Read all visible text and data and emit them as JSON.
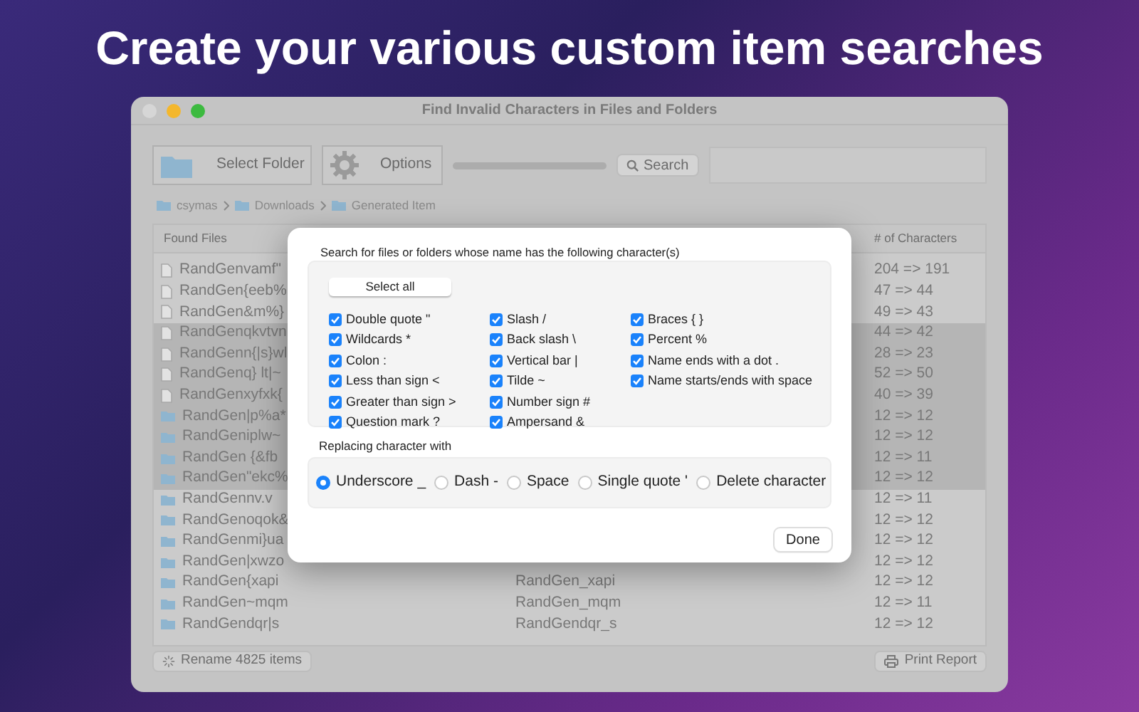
{
  "headline": "Create your various custom item searches",
  "window": {
    "title": "Find Invalid Characters in Files and Folders"
  },
  "toolbar": {
    "select_folder": "Select Folder",
    "options": "Options",
    "progress": {
      "level": 0
    },
    "search": "Search"
  },
  "breadcrumb": [
    "csymas",
    "Downloads",
    "Generated Item"
  ],
  "table": {
    "columns": [
      "Found Files",
      "# of Characters"
    ],
    "rows": [
      {
        "kind": "file",
        "selected": false,
        "name": "RandGenvamf\"",
        "characters": "204 => 191"
      },
      {
        "kind": "file",
        "selected": false,
        "name": "RandGen{eeb%",
        "characters": "47 => 44"
      },
      {
        "kind": "file",
        "selected": false,
        "name": "RandGen&m%}",
        "characters": "49 => 43"
      },
      {
        "kind": "file",
        "selected": true,
        "name": "RandGenqkvtvn",
        "characters": "44 => 42"
      },
      {
        "kind": "file",
        "selected": true,
        "name": "RandGenn{|s}wl",
        "characters": "28 => 23"
      },
      {
        "kind": "file",
        "selected": true,
        "name": "RandGenq} lt|~",
        "characters": "52 => 50"
      },
      {
        "kind": "file",
        "selected": true,
        "name": "RandGenxyfxk{",
        "characters": "40 => 39"
      },
      {
        "kind": "folder",
        "selected": true,
        "name": "RandGen|p%a*",
        "characters": "12 => 12"
      },
      {
        "kind": "folder",
        "selected": true,
        "name": "RandGeniplw~",
        "characters": "12 => 12"
      },
      {
        "kind": "folder",
        "selected": true,
        "name": "RandGen {&fb",
        "characters": "12 => 11"
      },
      {
        "kind": "folder",
        "selected": true,
        "name": "RandGen\"ekc%",
        "characters": "12 => 12"
      },
      {
        "kind": "folder",
        "selected": false,
        "name": "RandGennv.v",
        "characters": "12 => 11"
      },
      {
        "kind": "folder",
        "selected": false,
        "name": "RandGenoqok&",
        "characters": "12 => 12"
      },
      {
        "kind": "folder",
        "selected": false,
        "name": "RandGenmi}ua",
        "characters": "12 => 12"
      },
      {
        "kind": "folder",
        "selected": false,
        "name": "RandGen|xwzo",
        "characters": "12 => 12"
      },
      {
        "kind": "folder",
        "selected": false,
        "name": "RandGen{xapi",
        "column_2": "RandGen_xapi",
        "characters": "12 => 12"
      },
      {
        "kind": "folder",
        "selected": false,
        "name": "RandGen~mqm",
        "column_2": "RandGen_mqm",
        "characters": "12 => 11"
      },
      {
        "kind": "folder",
        "selected": false,
        "name": "RandGendqr|s",
        "column_2": "RandGendqr_s",
        "characters": "12 => 12"
      }
    ]
  },
  "footer": {
    "rename": "Rename 4825 items",
    "print": "Print Report"
  },
  "dialog": {
    "prompt": "Search for files or folders whose name has the following character(s)",
    "select_all": "Select all",
    "option_columns": [
      [
        {
          "label": "Double quote \"",
          "checked": true
        },
        {
          "label": "Wildcards *",
          "checked": true
        },
        {
          "label": "Colon :",
          "checked": true
        },
        {
          "label": "Less than sign <",
          "checked": true
        },
        {
          "label": "Greater than sign >",
          "checked": true
        },
        {
          "label": "Question mark ?",
          "checked": true
        }
      ],
      [
        {
          "label": "Slash /",
          "checked": true
        },
        {
          "label": "Back slash \\",
          "checked": true
        },
        {
          "label": "Vertical bar |",
          "checked": true
        },
        {
          "label": "Tilde ~",
          "checked": true
        },
        {
          "label": "Number sign #",
          "checked": true
        },
        {
          "label": "Ampersand &",
          "checked": true
        }
      ],
      [
        {
          "label": "Braces { }",
          "checked": true
        },
        {
          "label": "Percent %",
          "checked": true
        },
        {
          "label": "Name ends with a dot .",
          "checked": true
        },
        {
          "label": "Name starts/ends with space",
          "checked": true
        }
      ]
    ],
    "replace_label": "Replacing character with",
    "replacements": [
      {
        "label": "Underscore _",
        "selected": true
      },
      {
        "label": "Dash -",
        "selected": false
      },
      {
        "label": "Space",
        "selected": false
      },
      {
        "label": "Single quote '",
        "selected": false
      },
      {
        "label": "Delete character",
        "selected": false
      }
    ],
    "done": "Done"
  }
}
